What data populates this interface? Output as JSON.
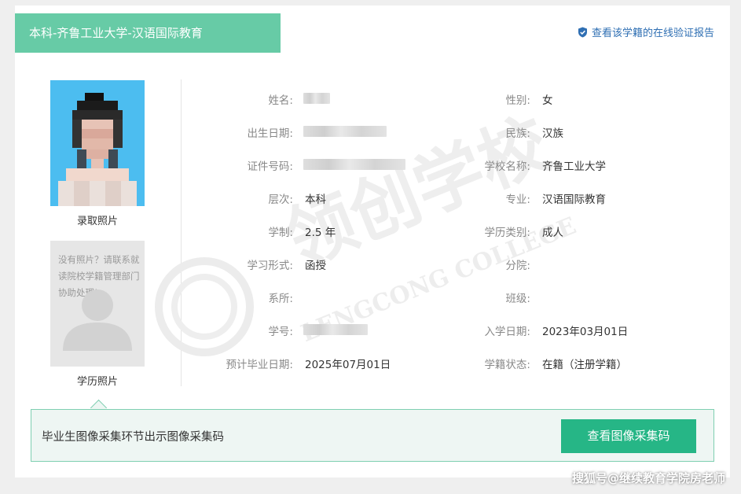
{
  "header": {
    "title": "本科-齐鲁工业大学-汉语国际教育",
    "verify_link": "查看该学籍的在线验证报告"
  },
  "photos": {
    "admission_caption": "录取照片",
    "education_caption": "学历照片",
    "no_photo_text": "没有照片？请联系就读院校学籍管理部门协助处理!"
  },
  "fields": {
    "name_label": "姓名:",
    "gender_label": "性别:",
    "gender_value": "女",
    "birth_label": "出生日期:",
    "ethnicity_label": "民族:",
    "ethnicity_value": "汉族",
    "id_label": "证件号码:",
    "school_label": "学校名称:",
    "school_value": "齐鲁工业大学",
    "level_label": "层次:",
    "level_value": "本科",
    "major_label": "专业:",
    "major_value": "汉语国际教育",
    "duration_label": "学制:",
    "duration_value": "2.5 年",
    "edu_type_label": "学历类别:",
    "edu_type_value": "成人",
    "study_form_label": "学习形式:",
    "study_form_value": "函授",
    "branch_label": "分院:",
    "branch_value": "",
    "department_label": "系所:",
    "department_value": "",
    "class_label": "班级:",
    "class_value": "",
    "student_no_label": "学号:",
    "enroll_date_label": "入学日期:",
    "enroll_date_value": "2023年03月01日",
    "grad_date_label": "预计毕业日期:",
    "grad_date_value": "2025年07月01日",
    "status_label": "学籍状态:",
    "status_value": "在籍（注册学籍）"
  },
  "notice": {
    "text": "毕业生图像采集环节出示图像采集码",
    "button": "查看图像采集码"
  },
  "watermark": {
    "main": "领创学校",
    "sub": "LENGCONG COLLEGE"
  },
  "source_mark": "搜狐号@继续教育学院房老师",
  "colors": {
    "title_bg": "#67cba6",
    "link": "#2f6fb3",
    "button_bg": "#26b686",
    "notice_bg": "#eef6f3"
  }
}
